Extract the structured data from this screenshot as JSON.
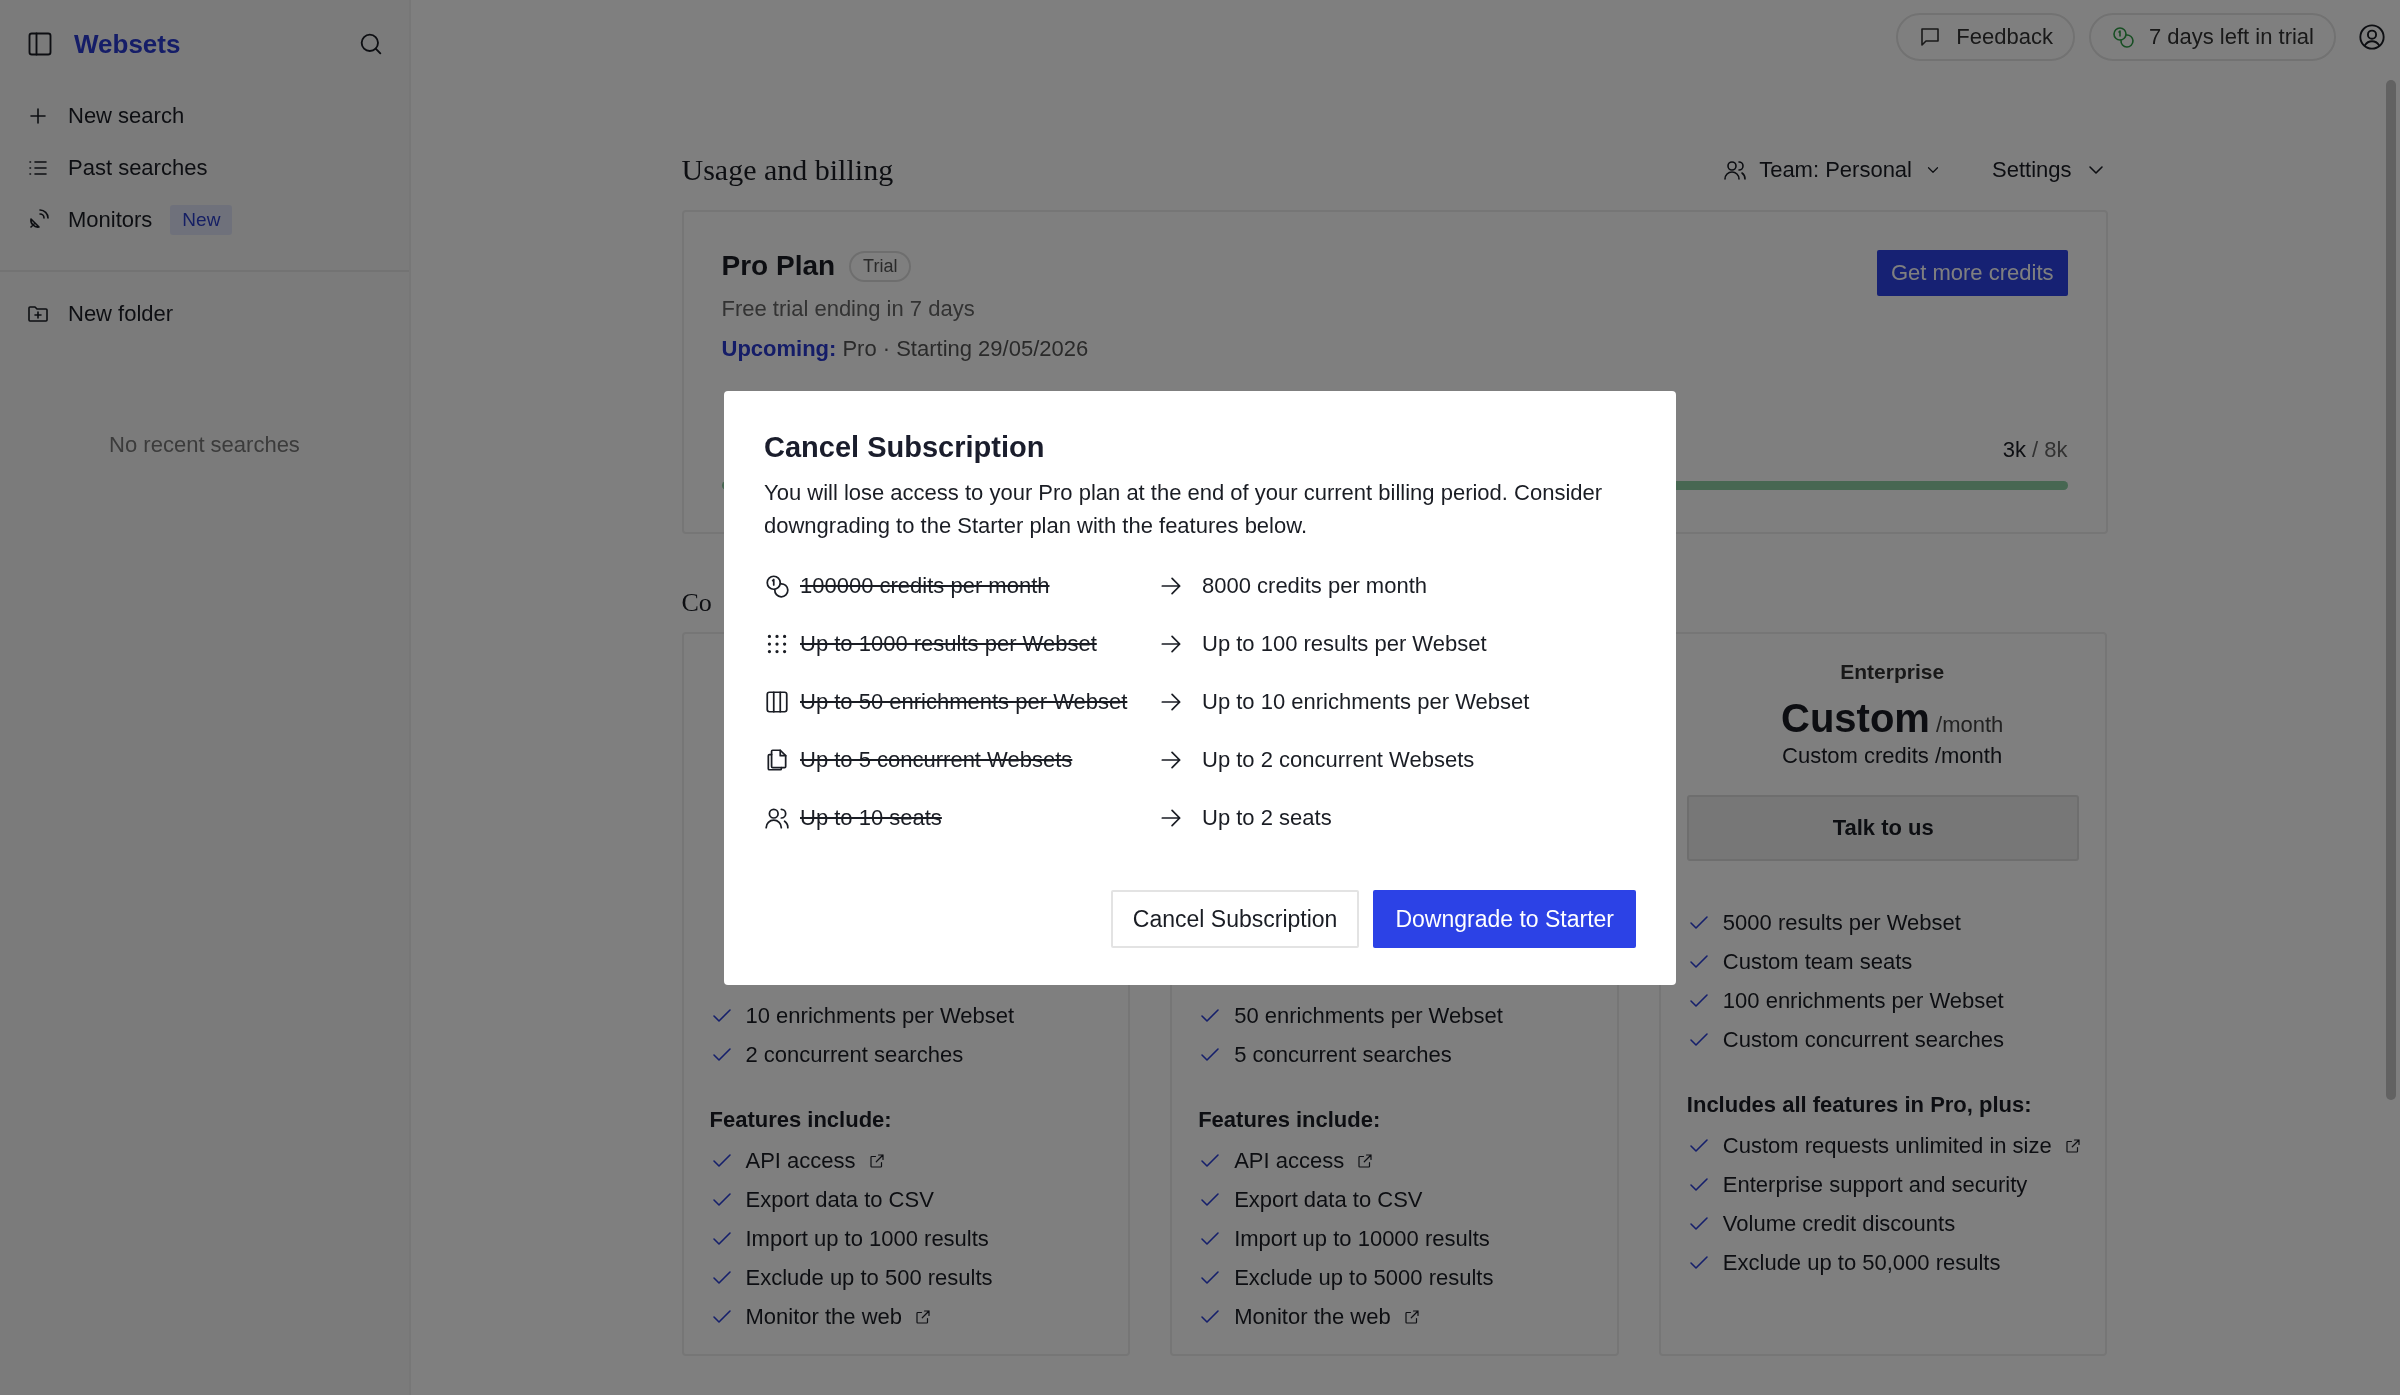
{
  "sidebar": {
    "title": "Websets",
    "items": [
      {
        "kind": "plus",
        "label": "New search"
      },
      {
        "kind": "list",
        "label": "Past searches"
      },
      {
        "kind": "satellite",
        "label": "Monitors",
        "badge": "New"
      }
    ],
    "folder_action": "New folder",
    "empty_text": "No recent searches"
  },
  "header": {
    "feedback": "Feedback",
    "trial": "7 days left in trial"
  },
  "page": {
    "title": "Usage and billing",
    "team": "Team: Personal",
    "settings": "Settings"
  },
  "plan": {
    "name": "Pro Plan",
    "badge": "Trial",
    "status": "Free trial ending in 7 days",
    "upcoming_label": "Upcoming:",
    "upcoming_text": "Pro · Starting 29/05/2026",
    "button": "Get more credits",
    "usage": "3k",
    "limit": "/ 8k",
    "level": 1
  },
  "section_title": "Co",
  "plans": [
    {
      "kind": "partial",
      "features": [
        {
          "text": "10 enrichments per Webset",
          "link": false
        },
        {
          "text": "2 concurrent searches",
          "link": false
        }
      ],
      "includes_title": "Features include:",
      "includes": [
        {
          "text": "API access",
          "link": true
        },
        {
          "text": "Export data to CSV",
          "link": false
        },
        {
          "text": "Import up to 1000 results",
          "link": false
        },
        {
          "text": "Exclude up to 500 results",
          "link": false
        },
        {
          "text": "Monitor the web",
          "link": true
        }
      ]
    },
    {
      "kind": "partial",
      "features": [
        {
          "text": "50 enrichments per Webset",
          "link": false
        },
        {
          "text": "5 concurrent searches",
          "link": false
        }
      ],
      "includes_title": "Features include:",
      "includes": [
        {
          "text": "API access",
          "link": true
        },
        {
          "text": "Export data to CSV",
          "link": false
        },
        {
          "text": "Import up to 10000 results",
          "link": false
        },
        {
          "text": "Exclude up to 5000 results",
          "link": false
        },
        {
          "text": "Monitor the web",
          "link": true
        }
      ]
    },
    {
      "kind": "full",
      "name": "Enterprise",
      "price": "Custom",
      "per": "/month",
      "credits": "Custom credits /month",
      "button": "Talk to us",
      "features": [
        {
          "text": "5000 results per Webset",
          "link": false
        },
        {
          "text": "Custom team seats",
          "link": false
        },
        {
          "text": "100 enrichments per Webset",
          "link": false
        },
        {
          "text": "Custom concurrent searches",
          "link": false
        }
      ],
      "includes_title": "Includes all features in Pro, plus:",
      "includes": [
        {
          "text": "Custom requests unlimited in size",
          "link": true
        },
        {
          "text": "Enterprise support and security",
          "link": false
        },
        {
          "text": "Volume credit discounts",
          "link": false
        },
        {
          "text": "Exclude up to 50,000 results",
          "link": false
        }
      ]
    }
  ],
  "modal": {
    "title": "Cancel Subscription",
    "text": "You will lose access to your Pro plan at the end of your current billing period. Consider downgrading to the Starter plan with the features below.",
    "changes": [
      {
        "kind": "credits",
        "old": "100000 credits per month",
        "new": "8000 credits per month"
      },
      {
        "kind": "results",
        "old": "Up to 1000 results per Webset",
        "new": "Up to 100 results per Webset"
      },
      {
        "kind": "enrichments",
        "old": "Up to 50 enrichments per Webset",
        "new": "Up to 10 enrichments per Webset"
      },
      {
        "kind": "websets",
        "old": "Up to 5 concurrent Websets",
        "new": "Up to 2 concurrent Websets"
      },
      {
        "kind": "seats",
        "old": "Up to 10 seats",
        "new": "Up to 2 seats"
      }
    ],
    "cancel_button": "Cancel Subscription",
    "confirm_button": "Downgrade to Starter"
  }
}
